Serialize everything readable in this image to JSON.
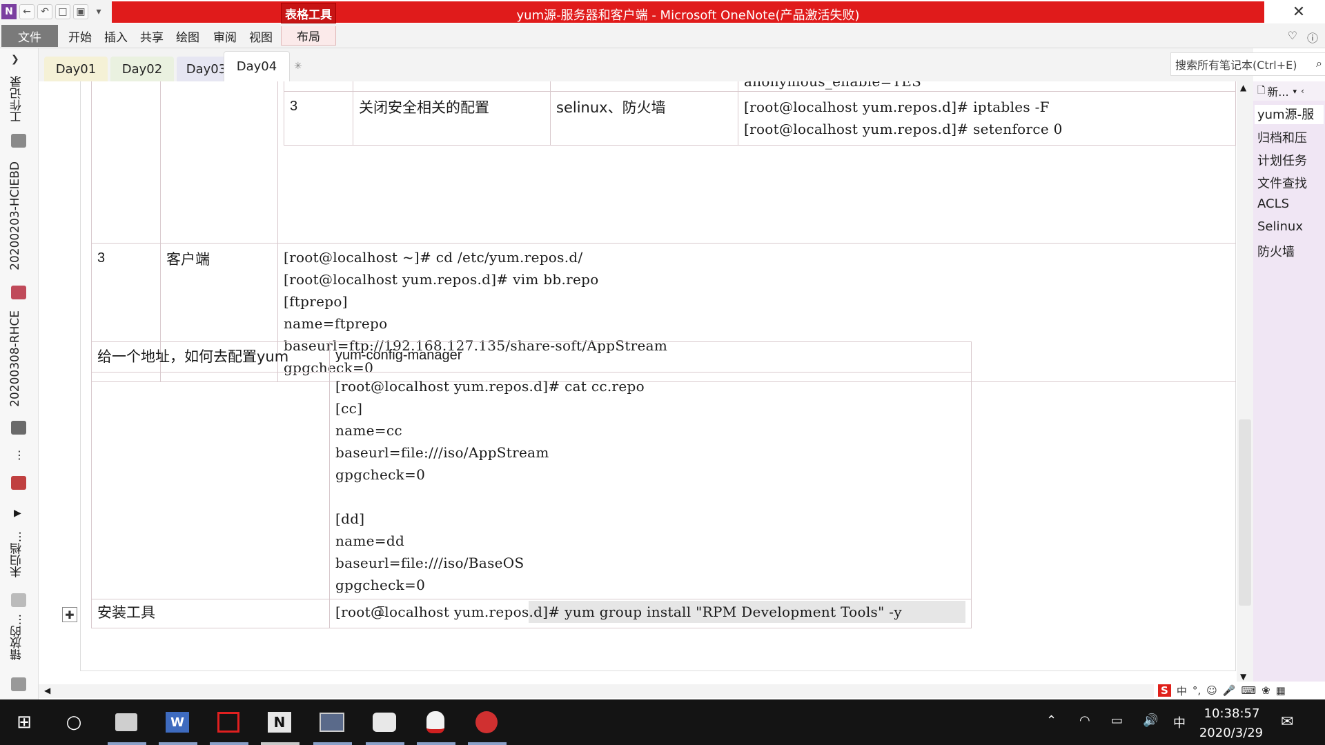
{
  "window": {
    "title": "yum源-服务器和客户端 - Microsoft OneNote(产品激活失败)",
    "contextual_tab_title": "表格工具"
  },
  "ribbon": {
    "tabs": [
      "文件",
      "开始",
      "插入",
      "共享",
      "绘图",
      "审阅",
      "视图"
    ],
    "contextual_tab": "布局"
  },
  "sections": [
    "Day01",
    "Day02",
    "Day03",
    "Day04"
  ],
  "active_section": "Day04",
  "search": {
    "placeholder": "搜索所有笔记本(Ctrl+E)"
  },
  "notebooks": [
    "工作记录",
    "20200203-HCIEBD",
    "20200308-RHCE",
    "未归档...",
    "错放的..."
  ],
  "pages": {
    "new_page_label": "新...",
    "items": [
      "yum源-服",
      "归档和压",
      "计划任务",
      "文件查找",
      "ACLS",
      "Selinux",
      "防火墙"
    ],
    "selected_index": 0
  },
  "table1": {
    "inner_partial_row": "anonymous_enable=YES",
    "inner_row": {
      "num": "3",
      "desc": "关闭安全相关的配置",
      "target": "selinux、防火墙",
      "commands": [
        "[root@localhost yum.repos.d]# iptables -F",
        "[root@localhost yum.repos.d]# setenforce 0"
      ]
    },
    "client_row": {
      "num": "3",
      "label": "客户端",
      "lines": [
        "[root@localhost ~]# cd /etc/yum.repos.d/",
        "[root@localhost yum.repos.d]# vim bb.repo",
        "[ftprepo]",
        "name=ftprepo",
        "baseurl=ftp://192.168.127.135/share-soft/AppStream",
        "gpgcheck=0"
      ]
    }
  },
  "table2": {
    "row1": {
      "question": "给一个地址，如何去配置yum",
      "answer": "yum-config-manager"
    },
    "row2": {
      "lines": [
        "[root@localhost yum.repos.d]# cat cc.repo",
        "[cc]",
        "name=cc",
        "baseurl=file:///iso/AppStream",
        "gpgcheck=0",
        "",
        "[dd]",
        "name=dd",
        "baseurl=file:///iso/BaseOS",
        "gpgcheck=0"
      ]
    },
    "row3": {
      "label": "安装工具",
      "command": "[root@localhost yum.repos.d]# yum group install \"RPM Development Tools\" -y"
    }
  },
  "taskbar": {
    "apps": [
      "file-explorer",
      "wps-writer",
      "screen-recorder",
      "onenote",
      "remote-desktop",
      "camera",
      "qq",
      "browser"
    ],
    "tray": {
      "ime": "中",
      "time": "10:38:57",
      "date": "2020/3/29"
    }
  },
  "colors": {
    "title_red": "#e01b1b",
    "page_list_bg": "#f0e6f4",
    "taskbar": "#141414"
  }
}
